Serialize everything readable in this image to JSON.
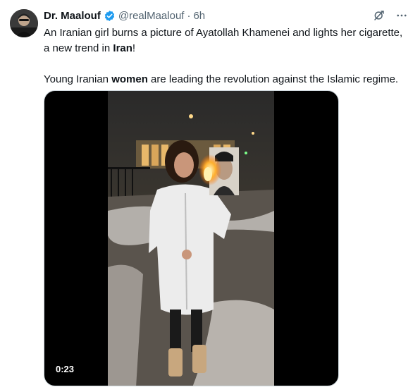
{
  "tweet": {
    "author_name": "Dr. Maalouf",
    "handle": "@realMaalouf",
    "separator": "·",
    "time": "6h",
    "text_line1_pre": "An Iranian girl burns a picture of Ayatollah Khamenei and lights her cigarette, a new trend in ",
    "text_line1_bold": "Iran",
    "text_line1_post": "!",
    "text_line2_pre": "Young Iranian ",
    "text_line2_bold": "women",
    "text_line2_post": " are leading the revolution against the Islamic regime.",
    "video_duration": "0:23"
  },
  "icons": {
    "verified": "verified-badge-icon",
    "grok": "grok-icon",
    "more": "more-icon"
  },
  "colors": {
    "verified_blue": "#1d9bf0",
    "secondary_text": "#536471",
    "primary_text": "#0f1419"
  }
}
